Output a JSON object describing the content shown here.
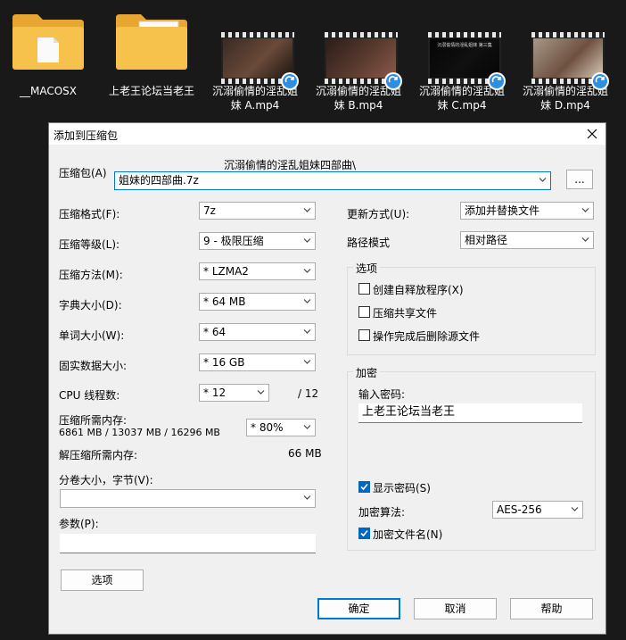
{
  "desktop": {
    "files": [
      {
        "name": "__MACOSX",
        "kind": "folder",
        "paper": false
      },
      {
        "name": "上老王论坛当老王",
        "kind": "folder",
        "paper": true
      },
      {
        "name": "沉溺偷情的淫乱姐妹 A.mp4",
        "kind": "video",
        "palette": [
          "#3a2a22",
          "#6a4a3a",
          "#1d1510"
        ]
      },
      {
        "name": "沉溺偷情的淫乱姐妹 B.mp4",
        "kind": "video",
        "palette": [
          "#2c1c18",
          "#5b3b30",
          "#8a5a48"
        ]
      },
      {
        "name": "沉溺偷情的淫乱姐妹 C.mp4",
        "kind": "video",
        "palette": [
          "#050505",
          "#101010",
          "#050505"
        ],
        "inner_text": "沉溺偷情的淫乱姐妹 第三集"
      },
      {
        "name": "沉溺偷情的淫乱姐妹 D.mp4",
        "kind": "video",
        "palette": [
          "#a89888",
          "#6e5040",
          "#d8c8b8"
        ]
      }
    ]
  },
  "dialog": {
    "title": "添加到压缩包",
    "archive": {
      "label": "压缩包(A)",
      "path": "沉溺偷情的淫乱姐妹四部曲\\",
      "name": "姐妹的四部曲.7z",
      "browse_label": "..."
    },
    "left": {
      "format": {
        "label": "压缩格式(F):",
        "value": "7z"
      },
      "level": {
        "label": "压缩等级(L):",
        "value": "9 - 极限压缩"
      },
      "method": {
        "label": "压缩方法(M):",
        "value": "*  LZMA2"
      },
      "dict": {
        "label": "字典大小(D):",
        "value": "*  64 MB"
      },
      "word": {
        "label": "单词大小(W):",
        "value": "*  64"
      },
      "solid": {
        "label": "固实数据大小:",
        "value": "*  16 GB"
      },
      "threads": {
        "label": "CPU 线程数:",
        "value": "*  12",
        "total": "/ 12"
      },
      "mem_compress": {
        "label": "压缩所需内存:",
        "detail": "6861 MB / 13037 MB / 16296 MB",
        "value": "*  80%"
      },
      "mem_decompress": {
        "label": "解压缩所需内存:",
        "value": "66 MB"
      },
      "volume": {
        "label": "分卷大小，字节(V):",
        "value": ""
      },
      "params": {
        "label": "参数(P):",
        "value": ""
      },
      "options_button": "选项"
    },
    "right": {
      "update": {
        "label": "更新方式(U):",
        "value": "添加并替换文件"
      },
      "path_mode": {
        "label": "路径模式",
        "value": "相对路径"
      },
      "options": {
        "title": "选项",
        "sfx": {
          "label": "创建自释放程序(X)",
          "checked": false
        },
        "shared": {
          "label": "压缩共享文件",
          "checked": false
        },
        "delete": {
          "label": "操作完成后删除源文件",
          "checked": false
        }
      },
      "encryption": {
        "title": "加密",
        "password_label": "输入密码:",
        "password": "上老王论坛当老王",
        "show": {
          "label": "显示密码(S)",
          "checked": true
        },
        "method_label": "加密算法:",
        "method": "AES-256",
        "names": {
          "label": "加密文件名(N)",
          "checked": true
        }
      }
    },
    "buttons": {
      "ok": "确定",
      "cancel": "取消",
      "help": "帮助"
    }
  }
}
